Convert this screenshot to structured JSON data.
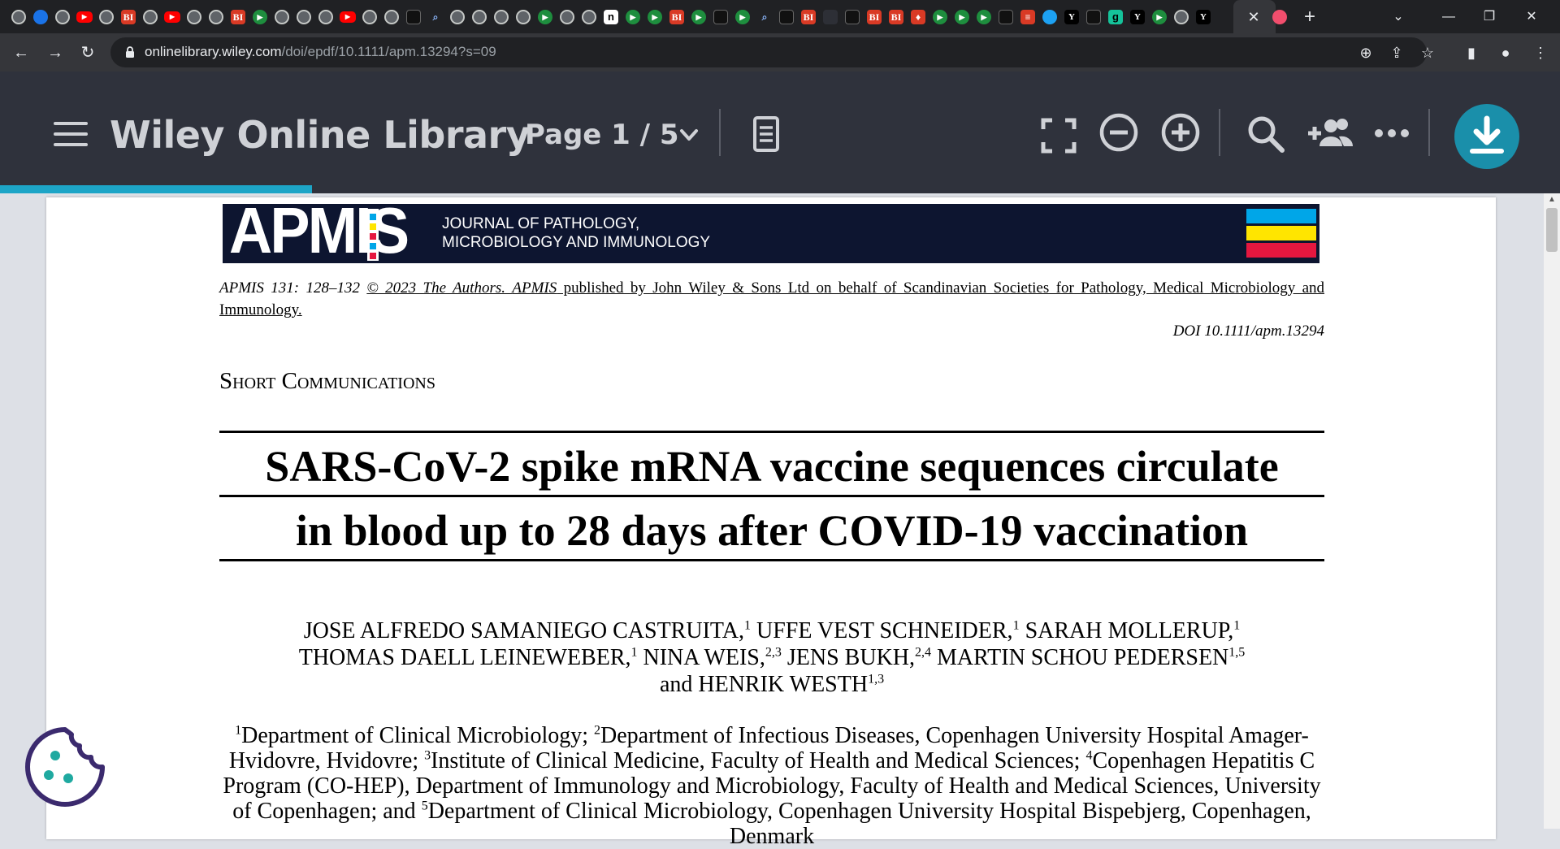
{
  "browser": {
    "tabs": [
      {
        "icon": "globe-favicon",
        "text": ""
      },
      {
        "icon": "chrome-favicon",
        "text": ""
      },
      {
        "icon": "globe-favicon",
        "text": ""
      },
      {
        "icon": "youtube-favicon",
        "text": "▶"
      },
      {
        "icon": "globe-favicon",
        "text": ""
      },
      {
        "icon": "bi-favicon",
        "text": "BI"
      },
      {
        "icon": "globe-favicon",
        "text": ""
      },
      {
        "icon": "youtube-favicon",
        "text": "▶"
      },
      {
        "icon": "globe-favicon",
        "text": ""
      },
      {
        "icon": "globe-favicon",
        "text": ""
      },
      {
        "icon": "bi-favicon",
        "text": "BI"
      },
      {
        "icon": "play-favicon",
        "text": "▶"
      },
      {
        "icon": "globe-favicon",
        "text": ""
      },
      {
        "icon": "globe-favicon",
        "text": ""
      },
      {
        "icon": "globe-favicon",
        "text": ""
      },
      {
        "icon": "youtube-favicon",
        "text": "▶"
      },
      {
        "icon": "globe-favicon",
        "text": ""
      },
      {
        "icon": "globe-favicon",
        "text": ""
      },
      {
        "icon": "dark-favicon",
        "text": ""
      },
      {
        "icon": "search-favicon",
        "text": "⌕"
      },
      {
        "icon": "globe-favicon",
        "text": ""
      },
      {
        "icon": "globe-favicon",
        "text": ""
      },
      {
        "icon": "globe-favicon",
        "text": ""
      },
      {
        "icon": "globe-favicon",
        "text": ""
      },
      {
        "icon": "play-favicon",
        "text": "▶"
      },
      {
        "icon": "globe-favicon",
        "text": ""
      },
      {
        "icon": "globe-favicon",
        "text": ""
      },
      {
        "icon": "n-favicon",
        "text": "n"
      },
      {
        "icon": "play-favicon",
        "text": "▶"
      },
      {
        "icon": "play-favicon",
        "text": "▶"
      },
      {
        "icon": "bi-favicon",
        "text": "BI"
      },
      {
        "icon": "play-favicon",
        "text": "▶"
      },
      {
        "icon": "dark-favicon",
        "text": ""
      },
      {
        "icon": "play-favicon",
        "text": "▶"
      },
      {
        "icon": "search-favicon",
        "text": "⌕"
      },
      {
        "icon": "dark-favicon",
        "text": ""
      },
      {
        "icon": "bi-favicon",
        "text": "BI"
      },
      {
        "icon": "wiley-favicon",
        "text": ""
      },
      {
        "icon": "dark-favicon",
        "text": ""
      },
      {
        "icon": "bi-favicon",
        "text": "BI"
      },
      {
        "icon": "bi-favicon",
        "text": "BI"
      },
      {
        "icon": "bi-favicon",
        "text": "♦"
      },
      {
        "icon": "play-favicon",
        "text": "▶"
      },
      {
        "icon": "play-favicon",
        "text": "▶"
      },
      {
        "icon": "play-favicon",
        "text": "▶"
      },
      {
        "icon": "dark-favicon",
        "text": ""
      },
      {
        "icon": "bi-favicon",
        "text": "≡"
      },
      {
        "icon": "twitter-favicon",
        "text": ""
      },
      {
        "icon": "y-favicon",
        "text": "Y"
      },
      {
        "icon": "dark-favicon",
        "text": ""
      },
      {
        "icon": "g-favicon",
        "text": "g"
      },
      {
        "icon": "y-favicon",
        "text": "Y"
      },
      {
        "icon": "play-favicon",
        "text": "▶"
      },
      {
        "icon": "globe-favicon",
        "text": ""
      },
      {
        "icon": "y-favicon",
        "text": "Y"
      }
    ],
    "active_tab_icon": "wiley-favicon",
    "pinned_after_active": "pink-favicon",
    "url_host": "onlinelibrary.wiley.com",
    "url_path": "/doi/epdf/10.1111/apm.13294?s=09"
  },
  "reader": {
    "brand": "Wiley Online Library",
    "page_indicator": "Page 1 / 5",
    "progress_percent": 20
  },
  "paper": {
    "journal_logo": "APMIS",
    "journal_subtitle_1": "JOURNAL OF PATHOLOGY,",
    "journal_subtitle_2": "MICROBIOLOGY AND IMMUNOLOGY",
    "citation_prefix": "APMIS 131: 128–132",
    "citation_copyright": "© 2023 The Authors.",
    "citation_journal": "APMIS",
    "citation_rest": " published by John Wiley & Sons Ltd on behalf of Scandinavian Societies for Pathology, Medical Microbiology and Immunology.",
    "doi": "DOI 10.1111/apm.13294",
    "section": "Short Communications",
    "title_line_1": "SARS-CoV-2 spike mRNA vaccine sequences circulate",
    "title_line_2": "in blood up to 28 days after COVID-19 vaccination",
    "authors": [
      {
        "name": "Jose Alfredo Samaniego Castruita,",
        "sup": "1"
      },
      {
        "name": "Uffe Vest Schneider,",
        "sup": "1"
      },
      {
        "name": "Sarah Mollerup,",
        "sup": "1"
      },
      {
        "name": "Thomas Daell Leineweber,",
        "sup": "1"
      },
      {
        "name": "Nina Weis,",
        "sup": "2,3"
      },
      {
        "name": "Jens Bukh,",
        "sup": "2,4"
      },
      {
        "name": "Martin Schou Pedersen",
        "sup": "1,5"
      },
      {
        "name": "Henrik Westh",
        "sup": "1,3"
      }
    ],
    "authors_and": "and",
    "affiliations": [
      {
        "sup": "1",
        "text": "Department of Clinical Microbiology; "
      },
      {
        "sup": "2",
        "text": "Department of Infectious Diseases, Copenhagen University Hospital Amager-Hvidovre, Hvidovre; "
      },
      {
        "sup": "3",
        "text": "Institute of Clinical Medicine, Faculty of Health and Medical Sciences; "
      },
      {
        "sup": "4",
        "text": "Copenhagen Hepatitis C Program (CO-HEP), Department of Immunology and Microbiology, Faculty of Health and Medical Sciences, University of Copenhagen; and "
      },
      {
        "sup": "5",
        "text": "Department of Clinical Microbiology, Copenhagen University Hospital Bispebjerg, Copenhagen, Denmark"
      }
    ]
  },
  "colors": {
    "reader_header": "#2f323c",
    "accent": "#1da5c7",
    "download_button": "#1a8faa",
    "banner": "#0d1530",
    "cookie": "#3b2a6e"
  }
}
